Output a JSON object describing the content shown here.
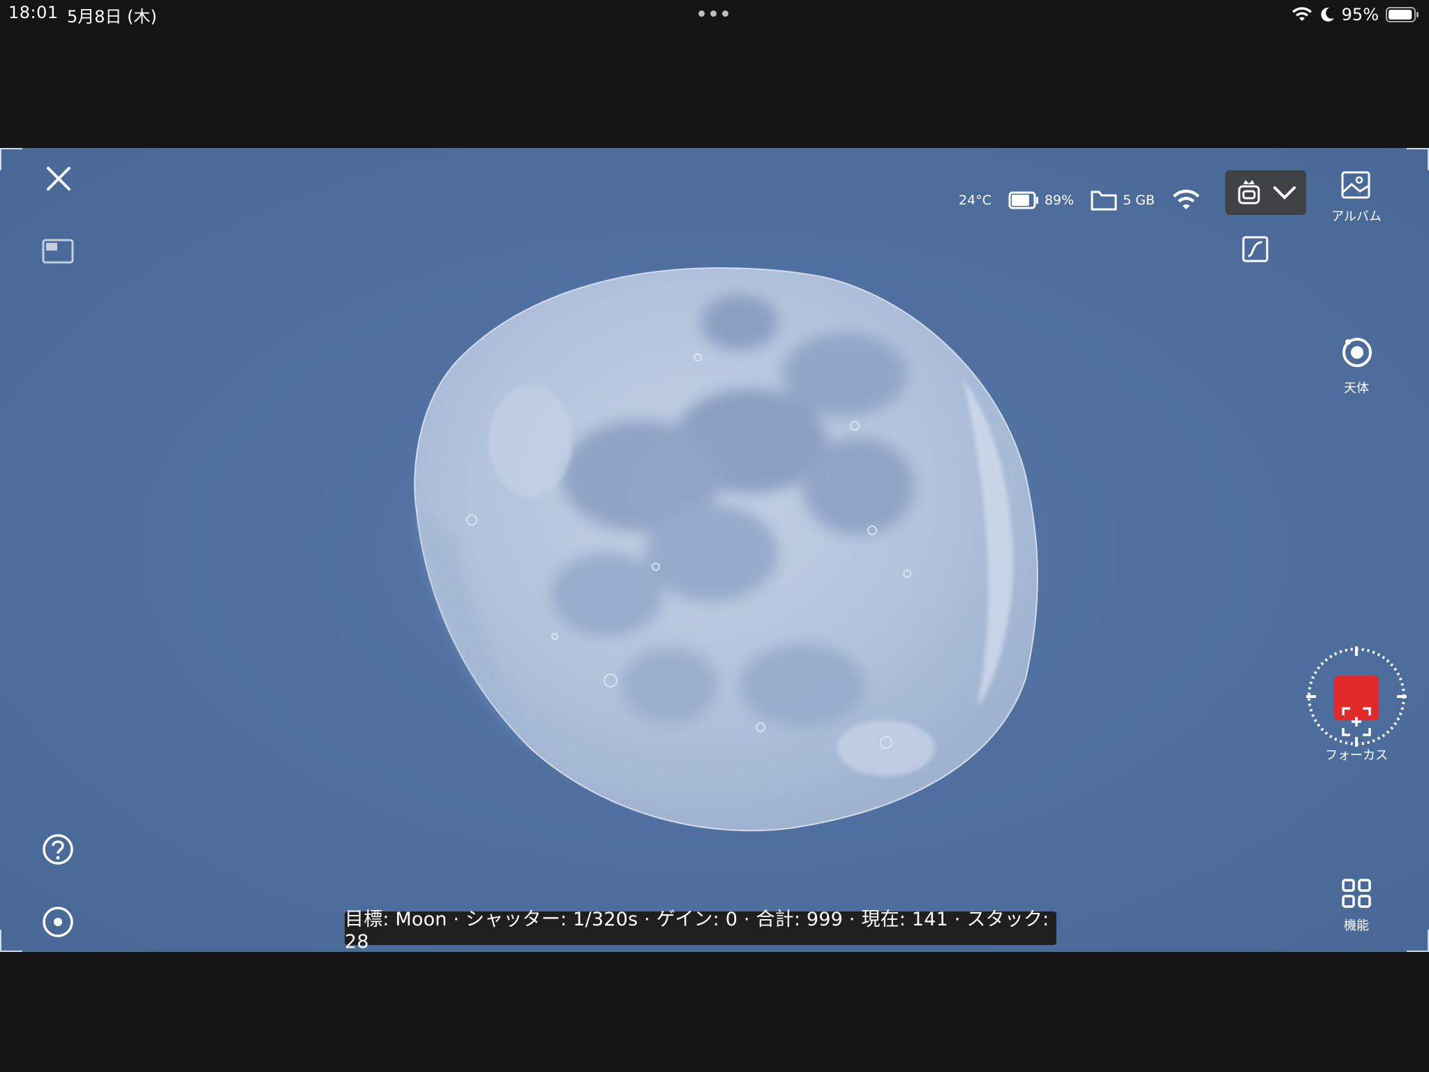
{
  "status_bar": {
    "time": "18:01",
    "date": "5月8日 (木)",
    "battery_percent": "95%",
    "battery_level": 0.95
  },
  "device_status": {
    "temperature": "24°C",
    "battery": "89%",
    "battery_level": 0.89,
    "storage": "5 GB"
  },
  "right_panel": {
    "album_label": "アルバム",
    "celestial_label": "天体",
    "focus_label": "フォーカス",
    "functions_label": "機能"
  },
  "info_bar": {
    "text": "目標: Moon · シャッター: 1/320s · ゲイン: 0 · 合計: 999 · 現在: 141 · スタック: 28"
  },
  "colors": {
    "sky": "#4e6f9f",
    "record_accent": "#e32a2a",
    "letterbox": "#141414",
    "device_selector_bg": "#3f4346"
  },
  "icons": {
    "close": "close-icon",
    "picture_in_picture": "picture-in-picture-icon",
    "help": "help-icon",
    "target": "target-icon",
    "curve": "curve-adjust-icon",
    "album": "album-icon",
    "celestial": "celestial-target-icon",
    "focus": "focus-icon",
    "functions": "grid-icon",
    "device": "telescope-device-icon"
  }
}
